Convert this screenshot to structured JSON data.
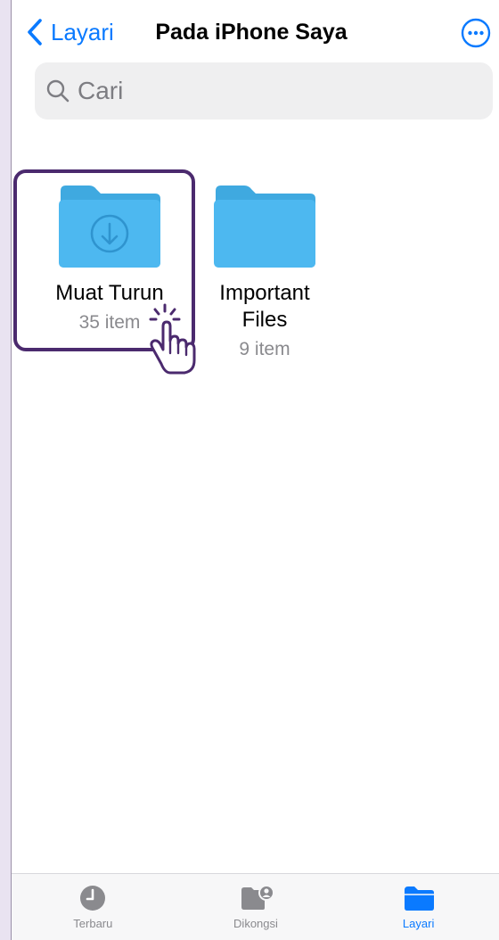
{
  "header": {
    "back_label": "Layari",
    "title": "Pada iPhone Saya",
    "more_icon": "ellipsis-circle-icon"
  },
  "search": {
    "placeholder": "Cari"
  },
  "folders": [
    {
      "name": "Muat Turun",
      "count": "35 item",
      "icon": "download-folder-icon",
      "highlighted": true
    },
    {
      "name": "Important Files",
      "count": "9 item",
      "icon": "folder-icon",
      "highlighted": false
    }
  ],
  "tabbar": {
    "items": [
      {
        "label": "Terbaru",
        "icon": "clock-icon",
        "active": false
      },
      {
        "label": "Dikongsi",
        "icon": "shared-folder-icon",
        "active": false
      },
      {
        "label": "Layari",
        "icon": "folder-icon",
        "active": true
      }
    ]
  },
  "colors": {
    "accent": "#0a7aff",
    "highlight": "#4b2a6e",
    "folder": "#3fb1ec"
  }
}
